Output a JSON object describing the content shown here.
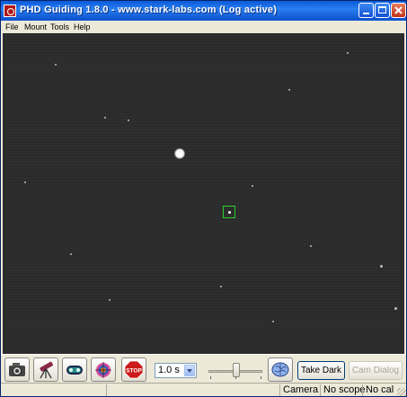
{
  "window": {
    "title": "PHD Guiding 1.8.0  -  www.stark-labs.com (Log active)"
  },
  "menu": {
    "items": [
      "File",
      "Mount",
      "Tools",
      "Help"
    ]
  },
  "toolbar": {
    "camera_icon": "camera-icon",
    "scope_icon": "telescope-icon",
    "loop_icon": "loop-icon",
    "guide_icon": "target-icon",
    "stop_label": "STOP",
    "exposure": "1.0 s",
    "brain_icon": "brain-icon",
    "take_dark_label": "Take Dark",
    "cam_dialog_label": "Cam Dialog"
  },
  "status": {
    "camera": "Camera",
    "scope": "No scope",
    "cal": "No cal"
  },
  "colors": {
    "title_bar": "#0a5ad8",
    "image_background": "#2b2b2b",
    "guide_box": "#2bcf2b",
    "stop_red": "#cc1a1a"
  }
}
